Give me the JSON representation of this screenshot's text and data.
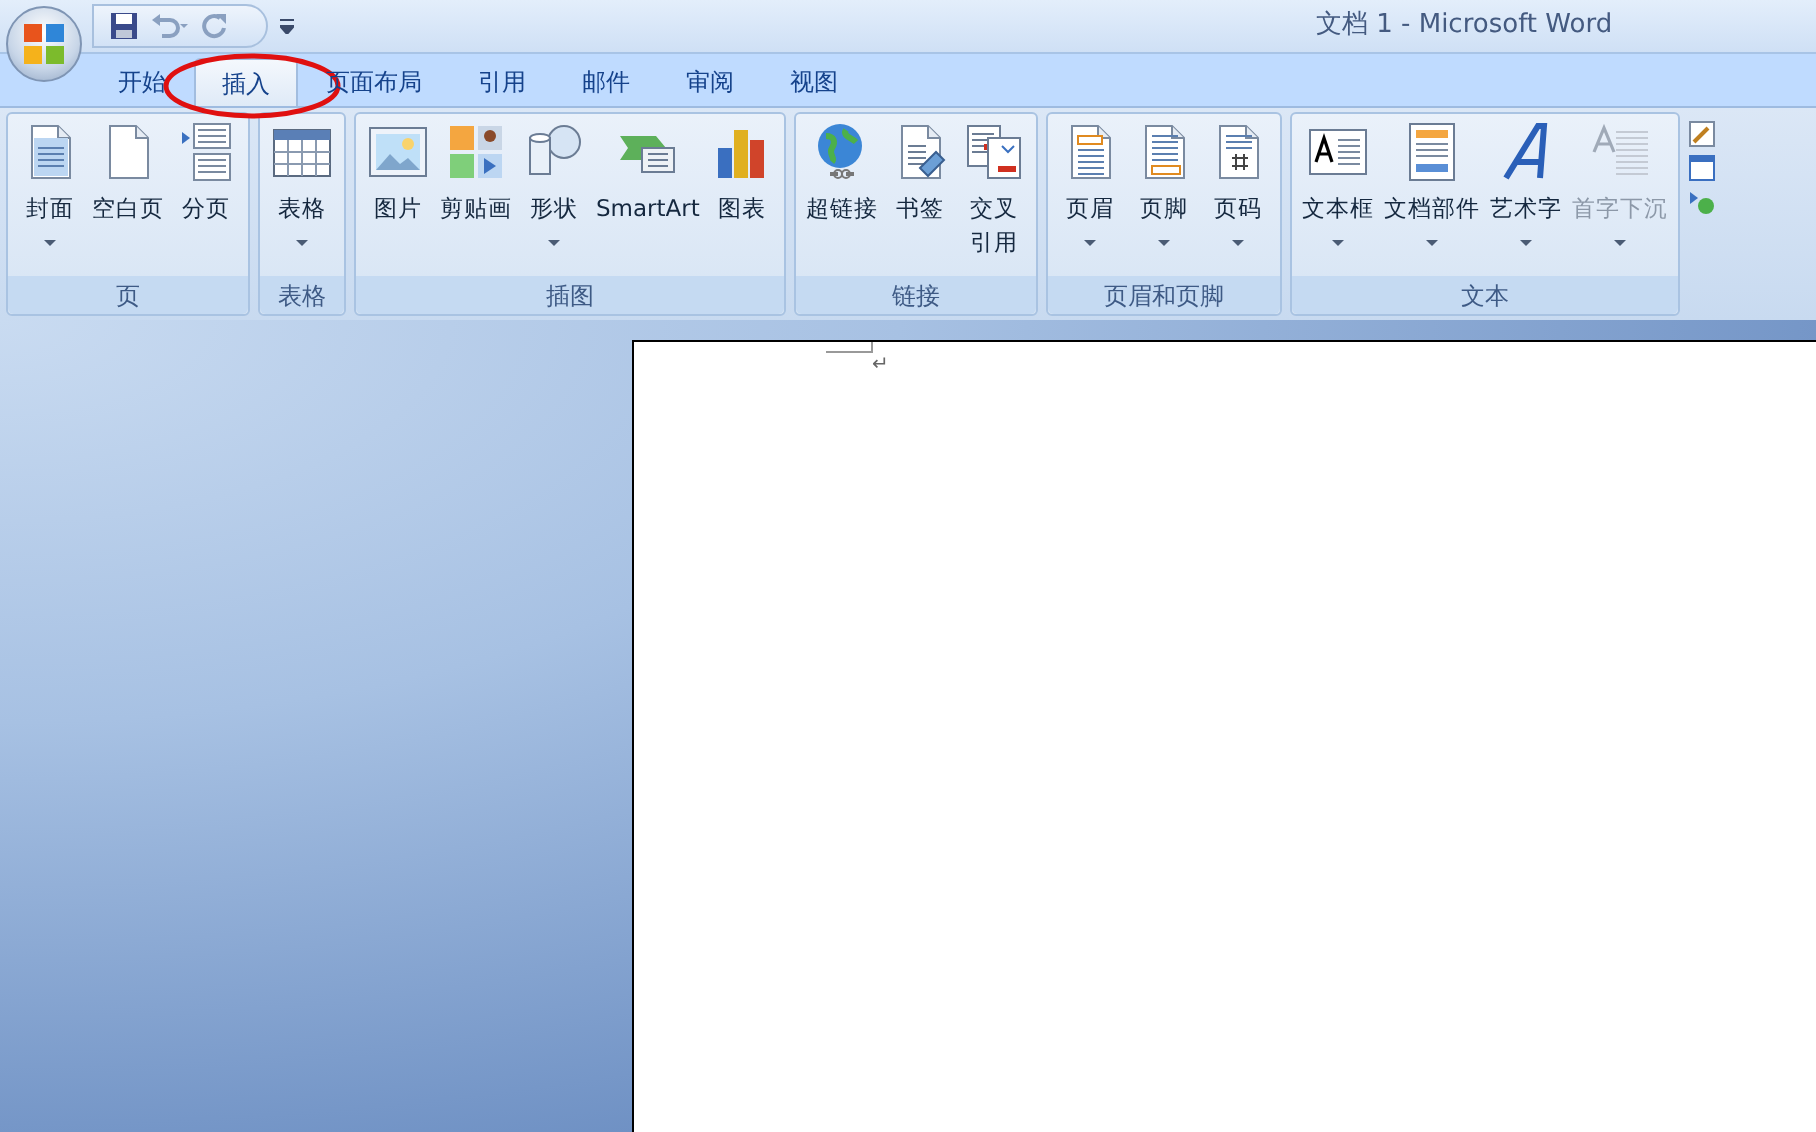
{
  "window": {
    "title": "文档 1 - Microsoft Word"
  },
  "tabs": [
    {
      "label": "开始",
      "selected": false,
      "circled": false
    },
    {
      "label": "插入",
      "selected": true,
      "circled": true
    },
    {
      "label": "页面布局",
      "selected": false,
      "circled": false
    },
    {
      "label": "引用",
      "selected": false,
      "circled": false
    },
    {
      "label": "邮件",
      "selected": false,
      "circled": false
    },
    {
      "label": "审阅",
      "selected": false,
      "circled": false
    },
    {
      "label": "视图",
      "selected": false,
      "circled": false
    }
  ],
  "ribbon_groups": [
    {
      "label": "页",
      "buttons": [
        {
          "label": "封面",
          "dropdown": true,
          "disabled": false
        },
        {
          "label": "空白页",
          "dropdown": false,
          "disabled": false
        },
        {
          "label": "分页",
          "dropdown": false,
          "disabled": false
        }
      ]
    },
    {
      "label": "表格",
      "buttons": [
        {
          "label": "表格",
          "dropdown": true,
          "disabled": false
        }
      ]
    },
    {
      "label": "插图",
      "buttons": [
        {
          "label": "图片",
          "dropdown": false,
          "disabled": false
        },
        {
          "label": "剪贴画",
          "dropdown": false,
          "disabled": false
        },
        {
          "label": "形状",
          "dropdown": true,
          "disabled": false
        },
        {
          "label": "SmartArt",
          "dropdown": false,
          "disabled": false
        },
        {
          "label": "图表",
          "dropdown": false,
          "disabled": false
        }
      ]
    },
    {
      "label": "链接",
      "buttons": [
        {
          "label": "超链接",
          "dropdown": false,
          "disabled": false
        },
        {
          "label": "书签",
          "dropdown": false,
          "disabled": false
        },
        {
          "label": [
            "交叉",
            "引用"
          ],
          "dropdown": false,
          "disabled": false
        }
      ]
    },
    {
      "label": "页眉和页脚",
      "buttons": [
        {
          "label": "页眉",
          "dropdown": true,
          "disabled": false
        },
        {
          "label": "页脚",
          "dropdown": true,
          "disabled": false
        },
        {
          "label": "页码",
          "dropdown": true,
          "disabled": false
        }
      ]
    },
    {
      "label": "文本",
      "buttons": [
        {
          "label": "文本框",
          "dropdown": true,
          "disabled": false
        },
        {
          "label": "文档部件",
          "dropdown": true,
          "disabled": false
        },
        {
          "label": "艺术字",
          "dropdown": true,
          "disabled": false
        },
        {
          "label": "首字下沉",
          "dropdown": true,
          "disabled": true
        }
      ]
    }
  ],
  "document": {
    "paragraph_mark": "↵"
  }
}
